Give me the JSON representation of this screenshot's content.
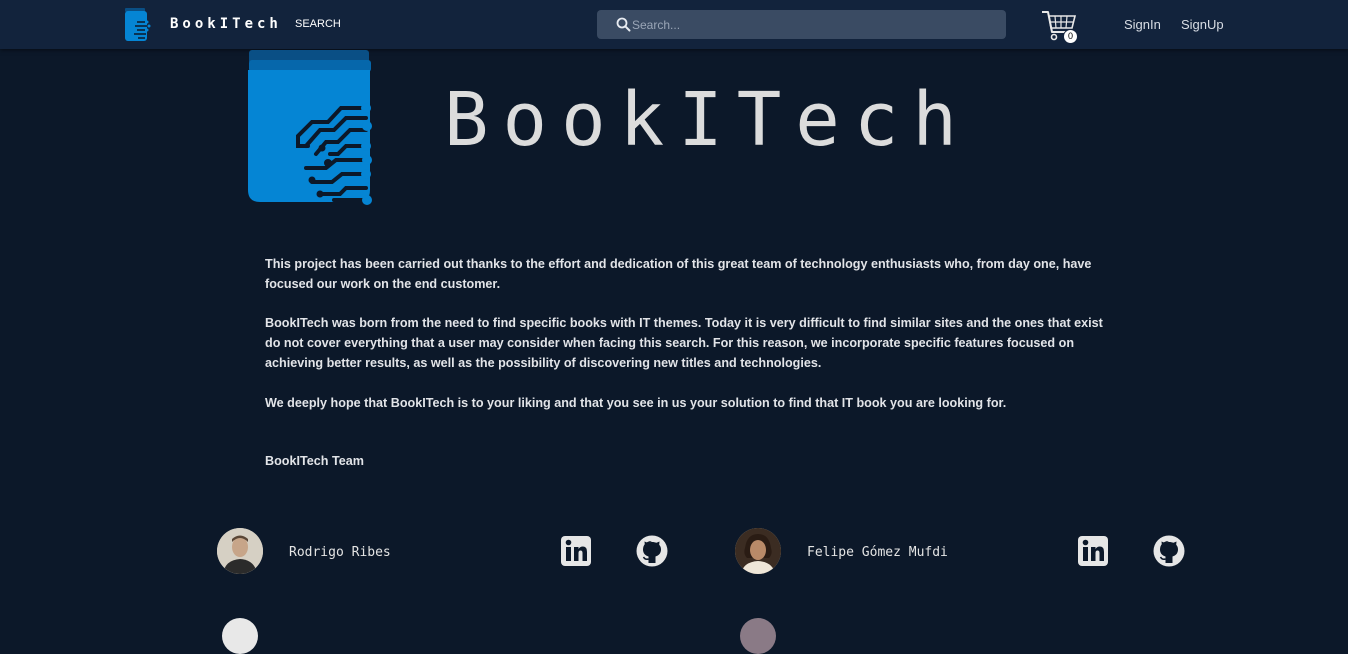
{
  "navbar": {
    "brand": "BookITech",
    "search_link": "SEARCH",
    "search_placeholder": "Search...",
    "cart_count": "0",
    "signin": "SignIn",
    "signup": "SignUp"
  },
  "hero": {
    "title": "BookITech"
  },
  "about": {
    "paragraphs": [
      "This project has been carried out thanks to the effort and dedication of this great team of technology enthusiasts who, from day one, have focused our work on the end customer.",
      "BookITech was born from the need to find specific books with IT themes. Today it is very difficult to find similar sites and the ones that exist do not cover everything that a user may consider when facing this search. For this reason, we incorporate specific features focused on achieving better results, as well as the possibility of discovering new titles and technologies.",
      "We deeply hope that BookITech is to your liking and that you see in us your solution to find that IT book you are looking for."
    ],
    "signature": "BookITech Team"
  },
  "team": [
    {
      "name": "Rodrigo Ribes"
    },
    {
      "name": "Felipe Gómez Mufdi"
    }
  ],
  "colors": {
    "background": "#0c1829",
    "navbar": "#12233c",
    "brand_blue": "#0585d4",
    "search_bg": "#3a4b63"
  }
}
